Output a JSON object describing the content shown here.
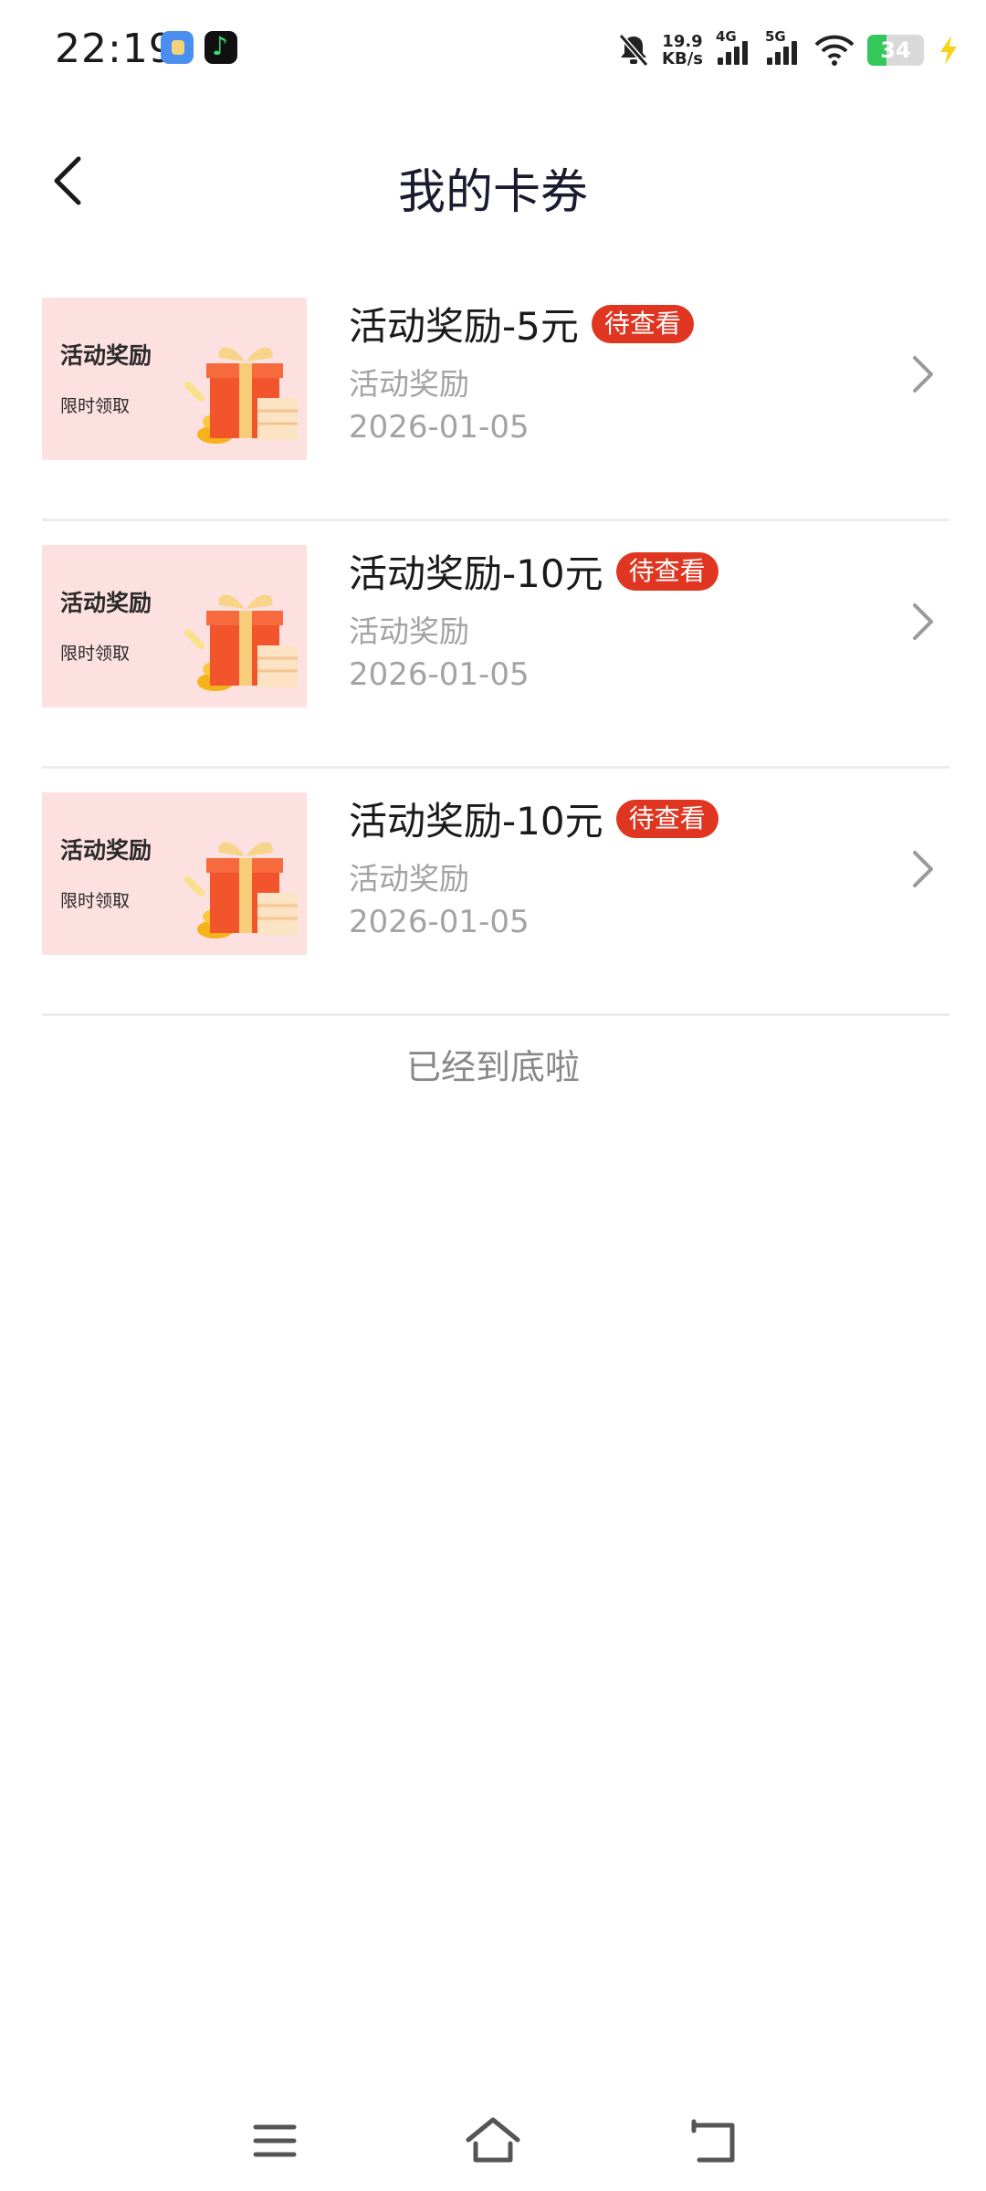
{
  "status_bar": {
    "time": "22:19",
    "net_speed_value": "19.9",
    "net_speed_unit": "KB/s",
    "signal_1_label": "4G",
    "signal_2_label": "5G",
    "battery_level": "34",
    "icons": [
      "notification-muted-icon",
      "wifi-icon",
      "charging-icon"
    ]
  },
  "header": {
    "title": "我的卡券"
  },
  "coupons": [
    {
      "thumb_title": "活动奖励",
      "thumb_subtitle": "限时领取",
      "title": "活动奖励-5元",
      "badge": "待查看",
      "subtitle": "活动奖励",
      "date": "2026-01-05"
    },
    {
      "thumb_title": "活动奖励",
      "thumb_subtitle": "限时领取",
      "title": "活动奖励-10元",
      "badge": "待查看",
      "subtitle": "活动奖励",
      "date": "2026-01-05"
    },
    {
      "thumb_title": "活动奖励",
      "thumb_subtitle": "限时领取",
      "title": "活动奖励-10元",
      "badge": "待查看",
      "subtitle": "活动奖励",
      "date": "2026-01-05"
    }
  ],
  "list_end_text": "已经到底啦",
  "colors": {
    "badge": "#e03520",
    "thumb_bg": "#fde0e0",
    "gift": "#f2552c"
  }
}
